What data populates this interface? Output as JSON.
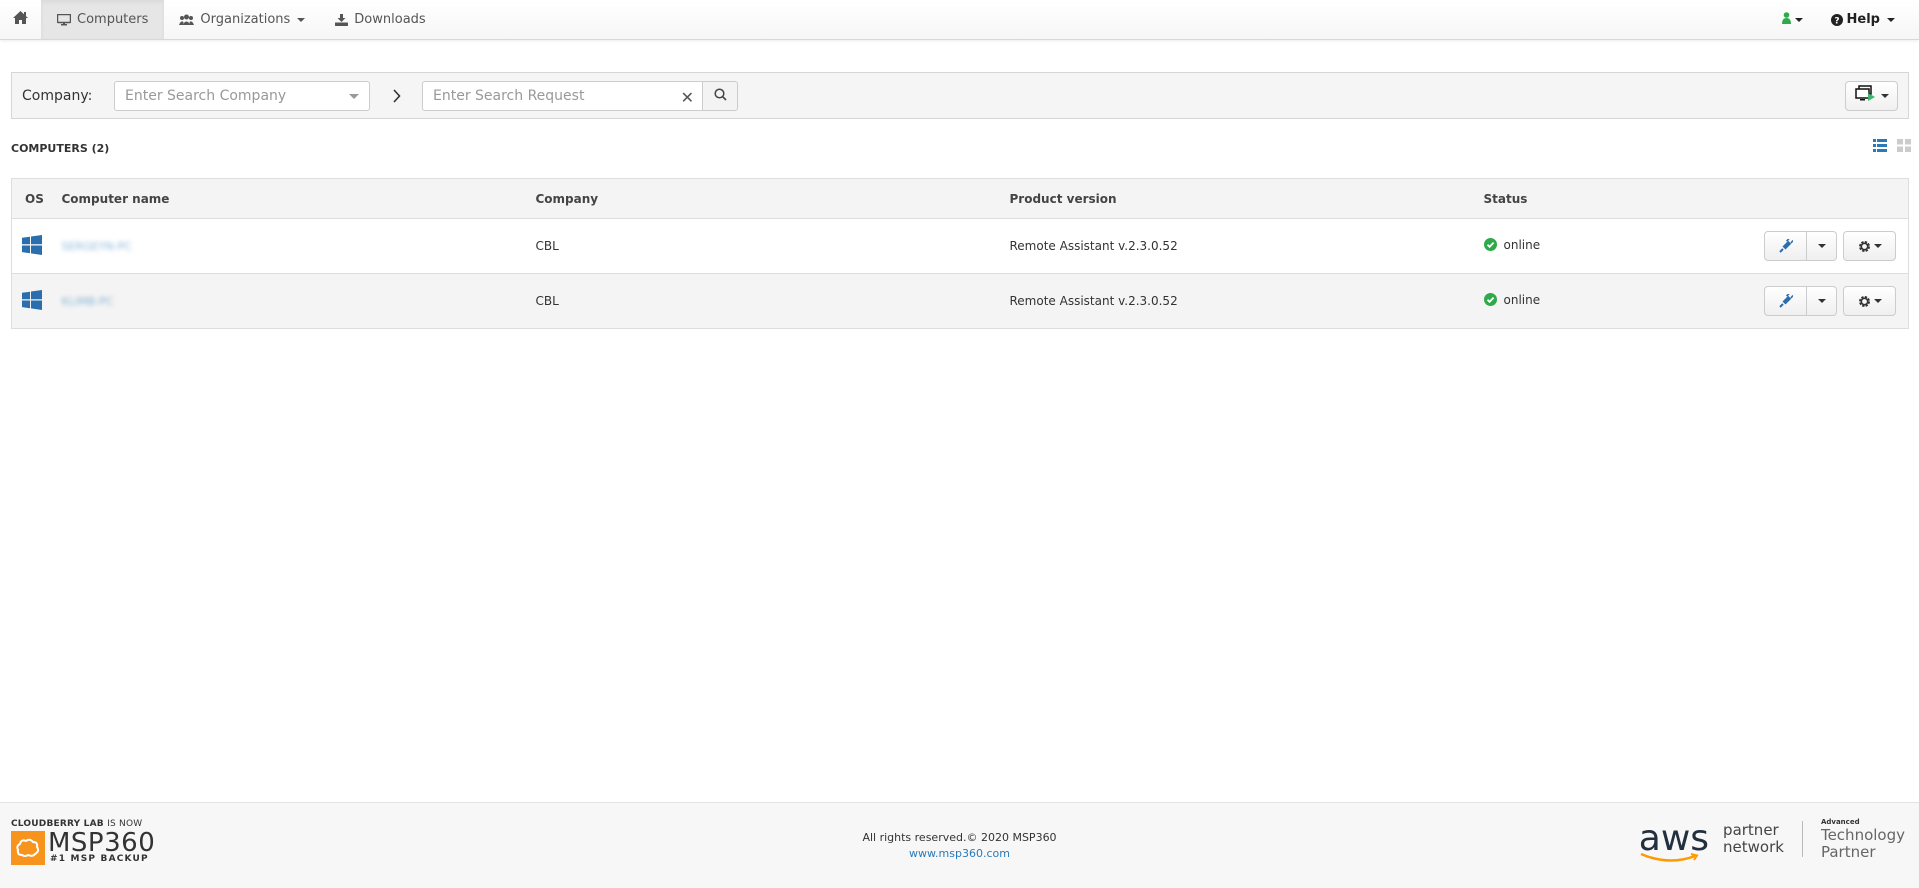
{
  "navbar": {
    "items": [
      {
        "label": "",
        "icon": "home-icon"
      },
      {
        "label": "Computers",
        "icon": "desktop-icon",
        "active": true
      },
      {
        "label": "Organizations",
        "icon": "users-icon",
        "has_dropdown": true
      },
      {
        "label": "Downloads",
        "icon": "download-icon"
      }
    ],
    "user_icon_color": "#2eaa4a",
    "help_label": "Help"
  },
  "toolbar": {
    "company_label": "Company:",
    "company_placeholder": "Enter Search Company",
    "search_placeholder": "Enter Search Request",
    "clear_symbol": "✕"
  },
  "section": {
    "title": "COMPUTERS (2)"
  },
  "table": {
    "columns": [
      "OS",
      "Computer name",
      "Company",
      "Product version",
      "Status"
    ],
    "rows": [
      {
        "os": "windows",
        "name": "SERGEYN-PC",
        "company": "CBL",
        "version": "Remote Assistant v.2.3.0.52",
        "status": "online"
      },
      {
        "os": "windows",
        "name": "KLIMB-PC",
        "company": "CBL",
        "version": "Remote Assistant v.2.3.0.52",
        "status": "online"
      }
    ]
  },
  "colors": {
    "accent": "#2a7ab9",
    "online": "#2eaa4a",
    "brand_orange": "#f7941d",
    "aws_orange": "#ff9900"
  },
  "footer": {
    "brand_prefix": "CLOUDBERRY LAB",
    "brand_now": "IS NOW",
    "brand_name": "MSP360",
    "brand_tag": "#1 MSP BACKUP",
    "copyright": "All rights reserved.© 2020 MSP360",
    "website": "www.msp360.com",
    "aws_word": "aws",
    "aws_partner_1": "partner",
    "aws_partner_2": "network",
    "aws_adv": "Advanced",
    "aws_tech_1": "Technology",
    "aws_tech_2": "Partner"
  }
}
